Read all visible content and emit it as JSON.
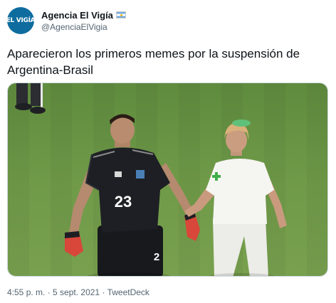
{
  "account": {
    "display_name": "Agencia El Vigía",
    "handle": "@AgenciaElVigia",
    "avatar_text": "EL VIGÍA",
    "verified_flag": "argentina-flag-icon"
  },
  "tweet": {
    "text": "Aparecieron los primeros memes por la suspensión de Argentina-Brasil"
  },
  "media": {
    "kind": "photo",
    "jersey_number": "23",
    "shorts_number": "2",
    "colors": {
      "pitch": "#6a8f45",
      "jersey": "#1d1f24",
      "nurse_uniform": "#f3f3f0",
      "gloves": "#d9463a",
      "cross": "#3fae4a"
    }
  },
  "footer": {
    "time": "4:55 p. m.",
    "separator": " · ",
    "date": "5 sept. 2021",
    "source": "TweetDeck"
  }
}
